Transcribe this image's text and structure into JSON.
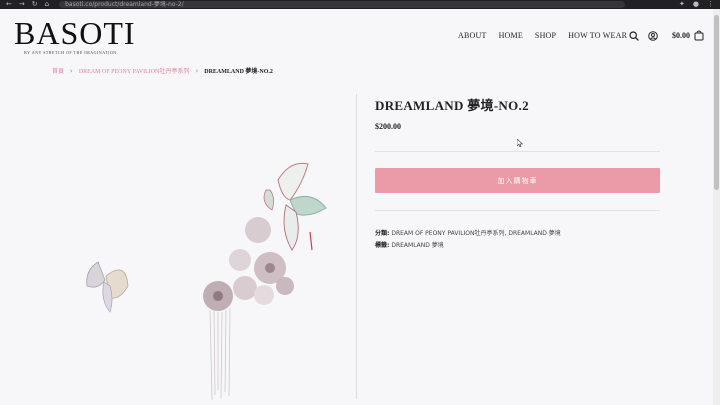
{
  "browser": {
    "url": "basoti.co/product/dreamland-夢境-no-2/",
    "nav_icons": [
      "back-icon",
      "forward-icon",
      "reload-icon",
      "home-icon"
    ],
    "ext_icons": [
      "extension-icon",
      "account-icon",
      "menu-icon"
    ]
  },
  "header": {
    "logo": "BASOTI",
    "tagline": "BY ANY STRETCH OF THE IMAGINATION",
    "nav": [
      "ABOUT",
      "HOME",
      "SHOP",
      "HOW TO WEAR"
    ],
    "cart_total": "$0.00"
  },
  "breadcrumb": {
    "home": "首頁",
    "category": "DREAM OF PEONY PAVILION牡丹亭系列",
    "current": "DREAMLAND 夢境-NO.2"
  },
  "product": {
    "title": "DREAMLAND 夢境-NO.2",
    "price": "$200.00",
    "add_to_cart": "加入購物車",
    "category_label": "分類:",
    "categories": "DREAM OF PEONY PAVILION牡丹亭系列, DREAMLAND 夢境",
    "tag_label": "標籤:",
    "tags": "DREAMLAND 夢境"
  },
  "colors": {
    "accent": "#eb9ba8",
    "breadcrumb_link": "#e0849a",
    "background": "#f7f7f9"
  }
}
